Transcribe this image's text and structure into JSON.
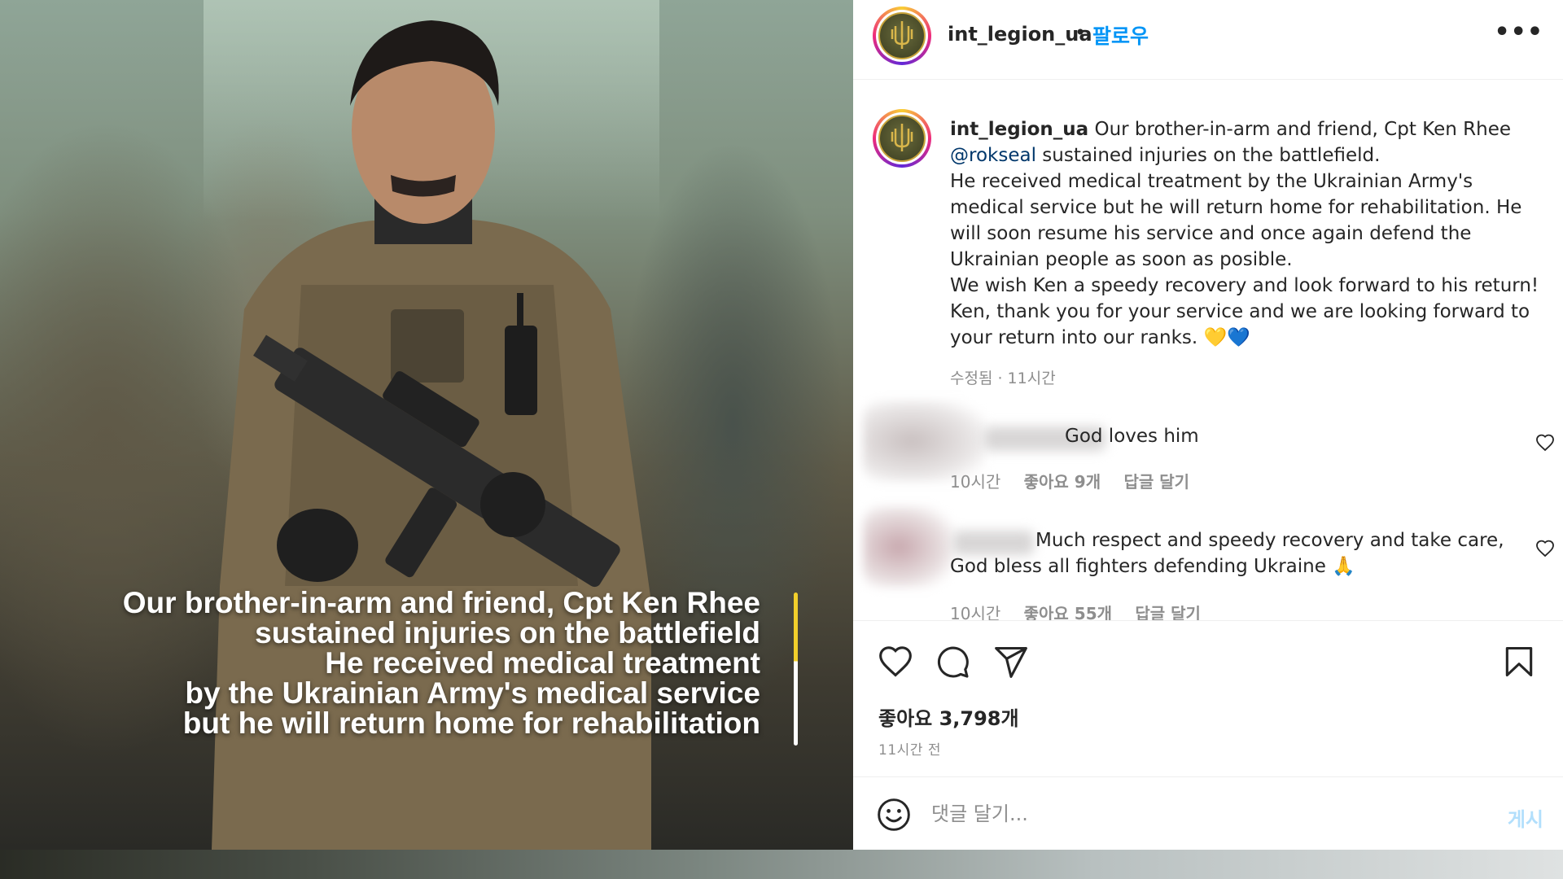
{
  "post_image": {
    "caption_lines": [
      "Our brother-in-arm and friend, Cpt Ken Rhee",
      "sustained injuries on the battlefield",
      "He received medical treatment",
      "by the Ukrainian Army's medical service",
      "but he will return home for rehabilitation"
    ],
    "caption_bar_colors": [
      "#f2cf2b",
      "#ffffff"
    ]
  },
  "header": {
    "username": "int_legion_ua",
    "separator": "•",
    "follow_label": "팔로우",
    "more_label": "•••"
  },
  "caption": {
    "username": "int_legion_ua",
    "text_1": " Our brother-in-arm and friend, Cpt Ken Rhee",
    "mention": "@rokseal",
    "text_2": " sustained injuries on the battlefield.",
    "paragraph_2": "He received medical treatment by the Ukrainian Army's medical service but he will return home for rehabilitation. He will soon resume his service and once again defend the Ukrainian people as soon as posible.",
    "paragraph_3": "We wish Ken a speedy recovery and look forward to his return!",
    "paragraph_4": "Ken, thank you for your service and we are looking forward to your return into our ranks. 💛💙",
    "meta": "수정됨 · 11시간"
  },
  "comments": [
    {
      "text": "God loves him",
      "time": "10시간",
      "likes": "좋아요 9개",
      "reply_label": "답글 달기"
    },
    {
      "text_line_1": "Much respect and speedy recovery and take care,",
      "text_line_2": "God bless all fighters defending Ukraine 🙏",
      "time": "10시간",
      "likes": "좋아요 55개",
      "reply_label": "답글 달기"
    }
  ],
  "actions": {
    "likes": "좋아요 3,798개",
    "posted": "11시간 전"
  },
  "add_comment": {
    "placeholder": "댓글 달기...",
    "post_label": "게시"
  },
  "colors": {
    "link_blue": "#0095f6",
    "mention_blue": "#00376b",
    "secondary_text": "#8e8e8e"
  }
}
